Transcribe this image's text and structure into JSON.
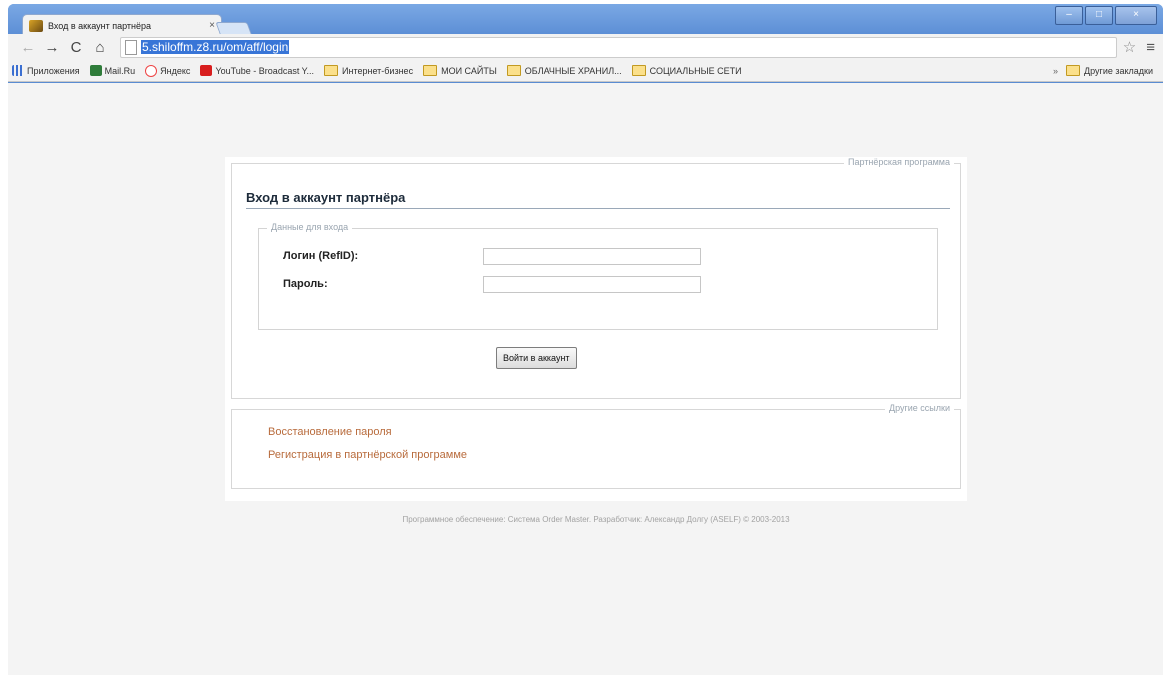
{
  "browser": {
    "tab_title": "Вход в аккаунт партнёра",
    "tab_close": "×",
    "url": "5.shiloffm.z8.ru/om/aff/login",
    "bookmarks": [
      {
        "label": "Приложения",
        "icon": "apps-grid-icon"
      },
      {
        "label": "Mail.Ru",
        "icon": "mailru-icon"
      },
      {
        "label": "Яндекс",
        "icon": "yandex-icon"
      },
      {
        "label": "YouTube - Broadcast Y...",
        "icon": "youtube-icon"
      },
      {
        "label": "Интернет-бизнес",
        "icon": "folder-icon"
      },
      {
        "label": "МОИ САЙТЫ",
        "icon": "folder-icon"
      },
      {
        "label": "ОБЛАЧНЫЕ ХРАНИЛ...",
        "icon": "folder-icon"
      },
      {
        "label": "СОЦИАЛЬНЫЕ СЕТИ",
        "icon": "folder-icon"
      }
    ],
    "bookmarks_more": "»",
    "other_bookmarks": "Другие закладки"
  },
  "login": {
    "section_legend": "Партнёрская программа",
    "heading": "Вход в аккаунт партнёра",
    "fieldset_legend": "Данные для входа",
    "login_label": "Логин (RefID):",
    "login_value": "",
    "password_label": "Пароль:",
    "password_value": "",
    "submit_label": "Войти в аккаунт"
  },
  "links": {
    "section_legend": "Другие ссылки",
    "items": [
      {
        "label": "Восстановление пароля"
      },
      {
        "label": "Регистрация в партнёрской программе"
      }
    ]
  },
  "footer": "Программное обеспечение: Система Order Master. Разработчик: Александр Долгу (ASELF) © 2003-2013",
  "colors": {
    "link": "#b86b3c",
    "chrome_frame": "#5a8cd2",
    "url_selection": "#3875d7"
  }
}
